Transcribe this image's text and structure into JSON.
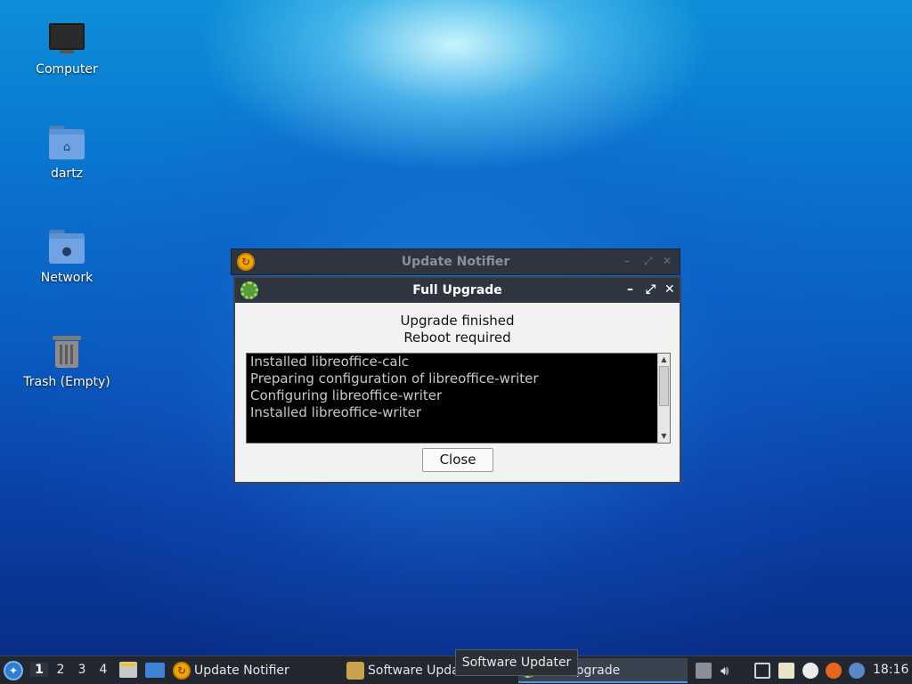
{
  "desktop": {
    "icons": [
      {
        "label": "Computer",
        "icon": "computer-icon"
      },
      {
        "label": "dartz",
        "icon": "home-folder-icon"
      },
      {
        "label": "Network",
        "icon": "network-folder-icon"
      },
      {
        "label": "Trash (Empty)",
        "icon": "trash-icon"
      }
    ]
  },
  "notifier_window": {
    "title": "Update Notifier",
    "controls": {
      "minimize": "–",
      "maximize": "⤢",
      "close": "✕"
    }
  },
  "dialog": {
    "title": "Full Upgrade",
    "controls": {
      "minimize": "–",
      "maximize": "⤢",
      "close": "✕"
    },
    "status_line1": "Upgrade finished",
    "status_line2": "Reboot required",
    "log_lines": [
      "Installed libreoffice-calc",
      "Preparing configuration of libreoffice-writer",
      "Configuring libreoffice-writer",
      "Installed libreoffice-writer"
    ],
    "close_label": "Close"
  },
  "taskbar": {
    "workspaces": [
      "1",
      "2",
      "3",
      "4"
    ],
    "active_workspace": "1",
    "tasks": [
      {
        "label": "Update Notifier"
      },
      {
        "label": "Software Updater"
      },
      {
        "label": "Full Upgrade"
      }
    ],
    "tooltip": "Software Updater",
    "clock": "18:16"
  }
}
